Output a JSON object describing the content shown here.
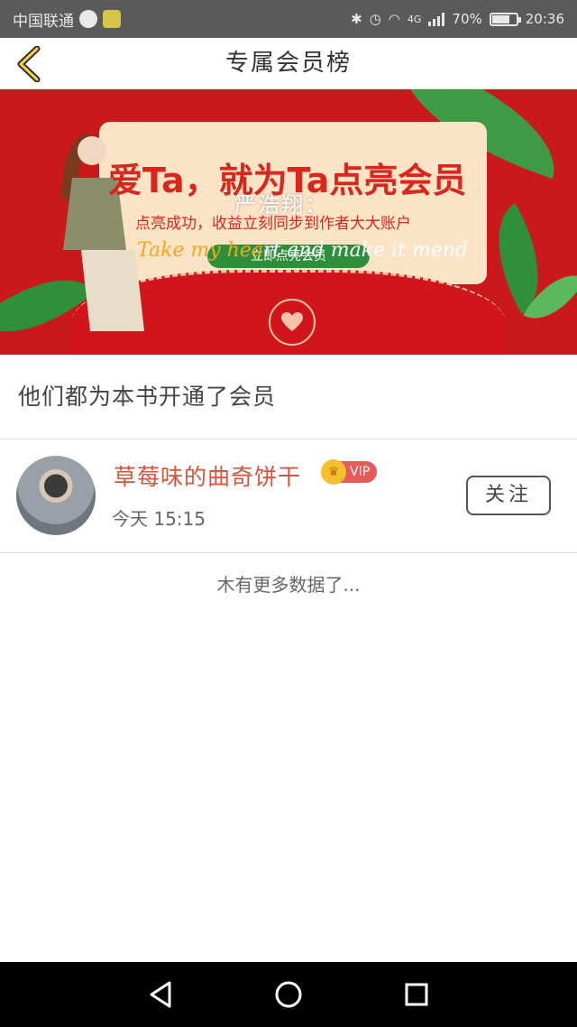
{
  "status_bar": {
    "carrier": "中国联通",
    "network": "4G",
    "battery": "70%",
    "battery_level": 0.7,
    "time": "20:36"
  },
  "nav": {
    "title": "专属会员榜",
    "back_icon": "chevron-left-icon"
  },
  "banner": {
    "title": "爱Ta，就为Ta点亮会员",
    "subtitle": "点亮成功，收益立刻同步到作者大大账户",
    "button_label": "立即点亮会员",
    "overlay_name": "严浩翔：",
    "overlay_lyric_a": "Take my hea",
    "overlay_lyric_b": "rt and make it mend",
    "colors": {
      "background": "#c9191b",
      "card": "#fbe3c6",
      "accent": "#2e8f3b"
    }
  },
  "section": {
    "title": "他们都为本书开通了会员"
  },
  "members": [
    {
      "name": "草莓味的曲奇饼干",
      "badge": "VIP",
      "time": "今天 15:15",
      "follow_label": "关注"
    }
  ],
  "footer": {
    "no_more": "木有更多数据了..."
  },
  "colors": {
    "name": "#d8533a",
    "vip": "#e75a5a",
    "status_bar": "#5a5a5a"
  }
}
